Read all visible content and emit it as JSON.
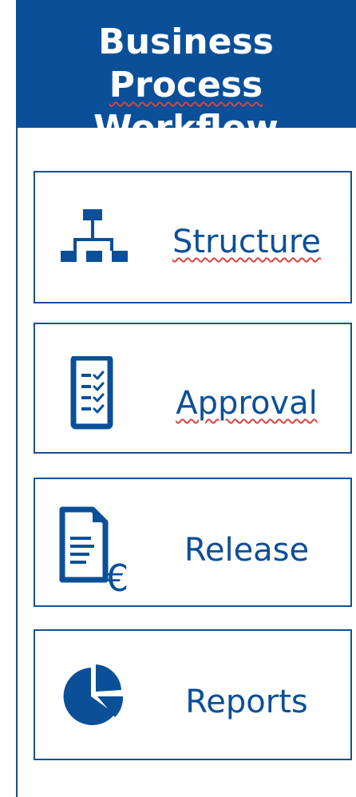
{
  "header": {
    "title_line1": "Business Process",
    "title_line2": "Workflow"
  },
  "colors": {
    "primary": "#0b4f98",
    "border": "#1b4f8d",
    "spellcheck": "#d84444"
  },
  "menu": {
    "items": [
      {
        "label": "Structure",
        "icon": "org-chart-icon"
      },
      {
        "label": "Approval",
        "icon": "checklist-icon"
      },
      {
        "label": "Release",
        "icon": "document-euro-icon"
      },
      {
        "label": "Reports",
        "icon": "pie-chart-icon"
      }
    ]
  }
}
